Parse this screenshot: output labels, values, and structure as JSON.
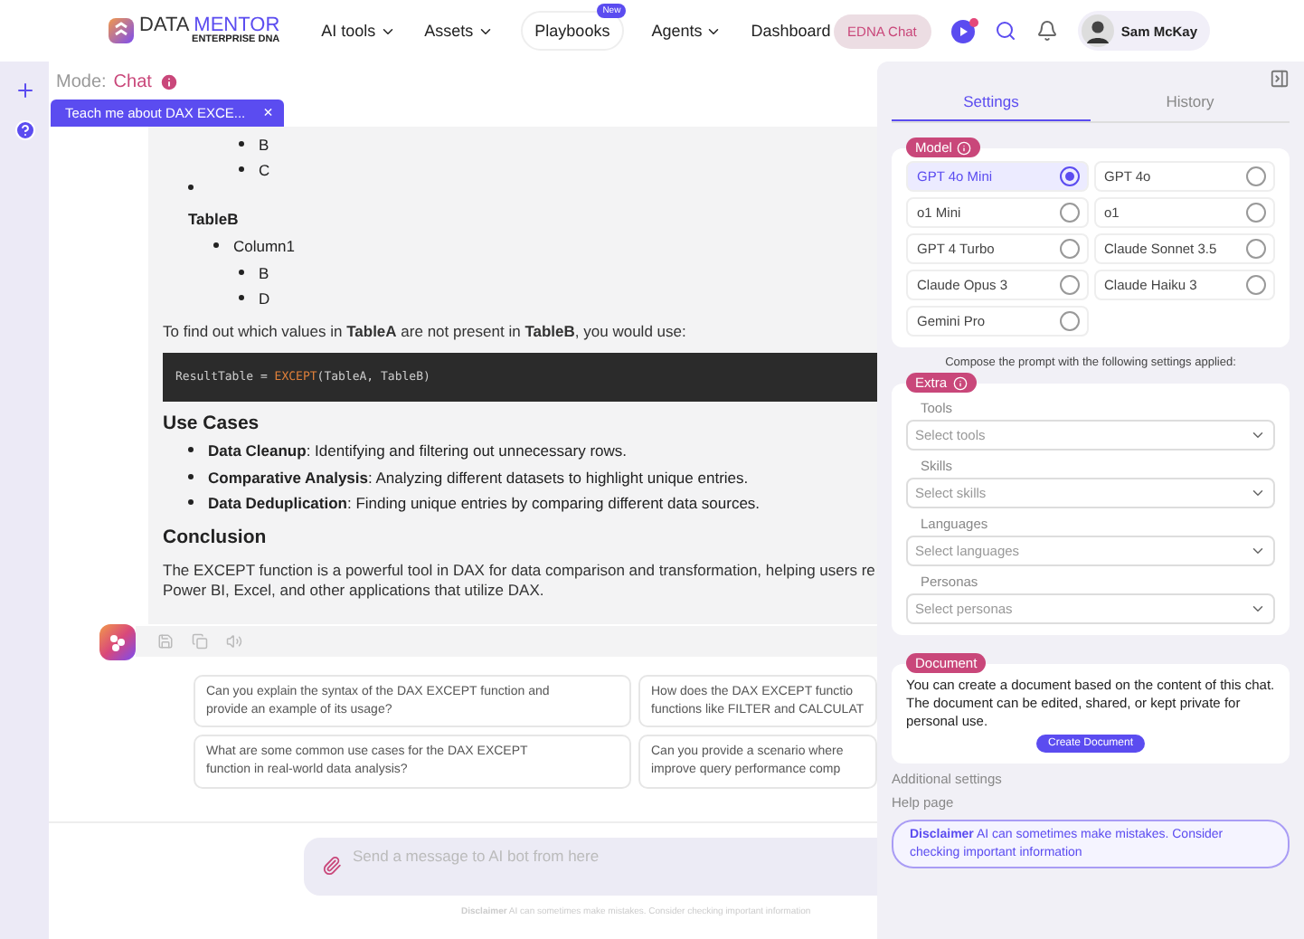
{
  "header": {
    "logo": {
      "word_1": "DATA",
      "word_2": "MENTOR",
      "subtitle": "ENTERPRISE DNA"
    },
    "nav": [
      {
        "label": "AI tools",
        "dropdown": true,
        "selected": false
      },
      {
        "label": "Assets",
        "dropdown": true,
        "selected": false
      },
      {
        "label": "Playbooks",
        "dropdown": false,
        "selected": true,
        "badge": "New"
      },
      {
        "label": "Agents",
        "dropdown": true,
        "selected": false
      },
      {
        "label": "Dashboard",
        "dropdown": false,
        "selected": false
      }
    ],
    "chat_button": "EDNA Chat",
    "user": {
      "name": "Sam McKay"
    }
  },
  "mode": {
    "label": "Mode:",
    "value": "Chat"
  },
  "chat_tab": {
    "label": "Teach me about DAX EXCE...",
    "close": "×"
  },
  "answer": [
    {
      "kind": "sublist",
      "items": [
        "B",
        "C"
      ]
    },
    {
      "kind": "bullet"
    },
    {
      "kind": "label",
      "text": "TableB"
    },
    {
      "kind": "outline",
      "items": [
        {
          "text": "Column1",
          "children": [
            {
              "text": "B"
            },
            {
              "text": "D"
            }
          ]
        }
      ]
    },
    {
      "kind": "paragraph",
      "lines": [
        "To find out which values in **TableA** are not present in **TableB**, you would use:"
      ]
    },
    {
      "kind": "code",
      "segments": [
        {
          "kind": "plain",
          "text": "ResultTable = "
        },
        {
          "kind": "keyword",
          "text": "EXCEPT"
        },
        {
          "kind": "plain",
          "text": "(TableA, TableB)"
        }
      ]
    },
    {
      "kind": "heading",
      "text": "Use Cases"
    },
    {
      "kind": "list",
      "items": [
        "**Data Cleanup**: Identifying and filtering out unnecessary rows.",
        "**Comparative Analysis**: Analyzing different datasets to highlight unique entries.",
        "**Data Deduplication**: Finding unique entries by comparing different data sources."
      ]
    },
    {
      "kind": "heading",
      "text": "Conclusion"
    },
    {
      "kind": "paragraph",
      "lines": [
        "The EXCEPT function is a powerful tool in DAX for data comparison and transformation, helping users re",
        "Power BI, Excel, and other applications that utilize DAX."
      ]
    }
  ],
  "suggestions": [
    {
      "lines": [
        "Can you explain the syntax of the DAX EXCEPT function and",
        "provide an example of its usage?"
      ]
    },
    {
      "lines": [
        "How does the DAX EXCEPT functio",
        "functions like FILTER and CALCULAT"
      ]
    },
    {
      "lines": [
        "What are some common use cases for the DAX EXCEPT",
        "function in real-world data analysis?"
      ]
    },
    {
      "lines": [
        "Can you provide a scenario where",
        "improve query performance comp"
      ]
    }
  ],
  "input": {
    "placeholder": "Send a message to AI bot from here"
  },
  "footer_disclaimer": {
    "title": "Disclaimer",
    "text": "AI can sometimes make mistakes. Consider checking important information"
  },
  "panel": {
    "tabs": [
      {
        "label": "Settings",
        "selected": true
      },
      {
        "label": "History",
        "selected": false
      }
    ],
    "model": {
      "title": "Model",
      "options": [
        {
          "label": "GPT 4o Mini",
          "selected": true
        },
        {
          "label": "GPT 4o",
          "selected": false
        },
        {
          "label": "o1 Mini",
          "selected": false
        },
        {
          "label": "o1",
          "selected": false
        },
        {
          "label": "GPT 4 Turbo",
          "selected": false
        },
        {
          "label": "Claude Sonnet 3.5",
          "selected": false
        },
        {
          "label": "Claude Opus 3",
          "selected": false
        },
        {
          "label": "Claude Haiku 3",
          "selected": false
        },
        {
          "label": "Gemini Pro",
          "selected": false
        }
      ]
    },
    "compose_note": "Compose the prompt with the following settings applied:",
    "extra": {
      "title": "Extra",
      "fields": [
        {
          "label": "Tools",
          "placeholder": "Select tools"
        },
        {
          "label": "Skills",
          "placeholder": "Select skills"
        },
        {
          "label": "Languages",
          "placeholder": "Select languages"
        },
        {
          "label": "Personas",
          "placeholder": "Select personas"
        }
      ]
    },
    "document": {
      "title": "Document",
      "text": "You can create a document based on the content of this chat. The document can be edited, shared, or kept private for personal use.",
      "button": "Create Document"
    },
    "links": [
      "Additional settings",
      "Help page"
    ],
    "disclaimer": {
      "title": "Disclaimer",
      "text": "AI can sometimes make mistakes. Consider checking important information"
    }
  }
}
